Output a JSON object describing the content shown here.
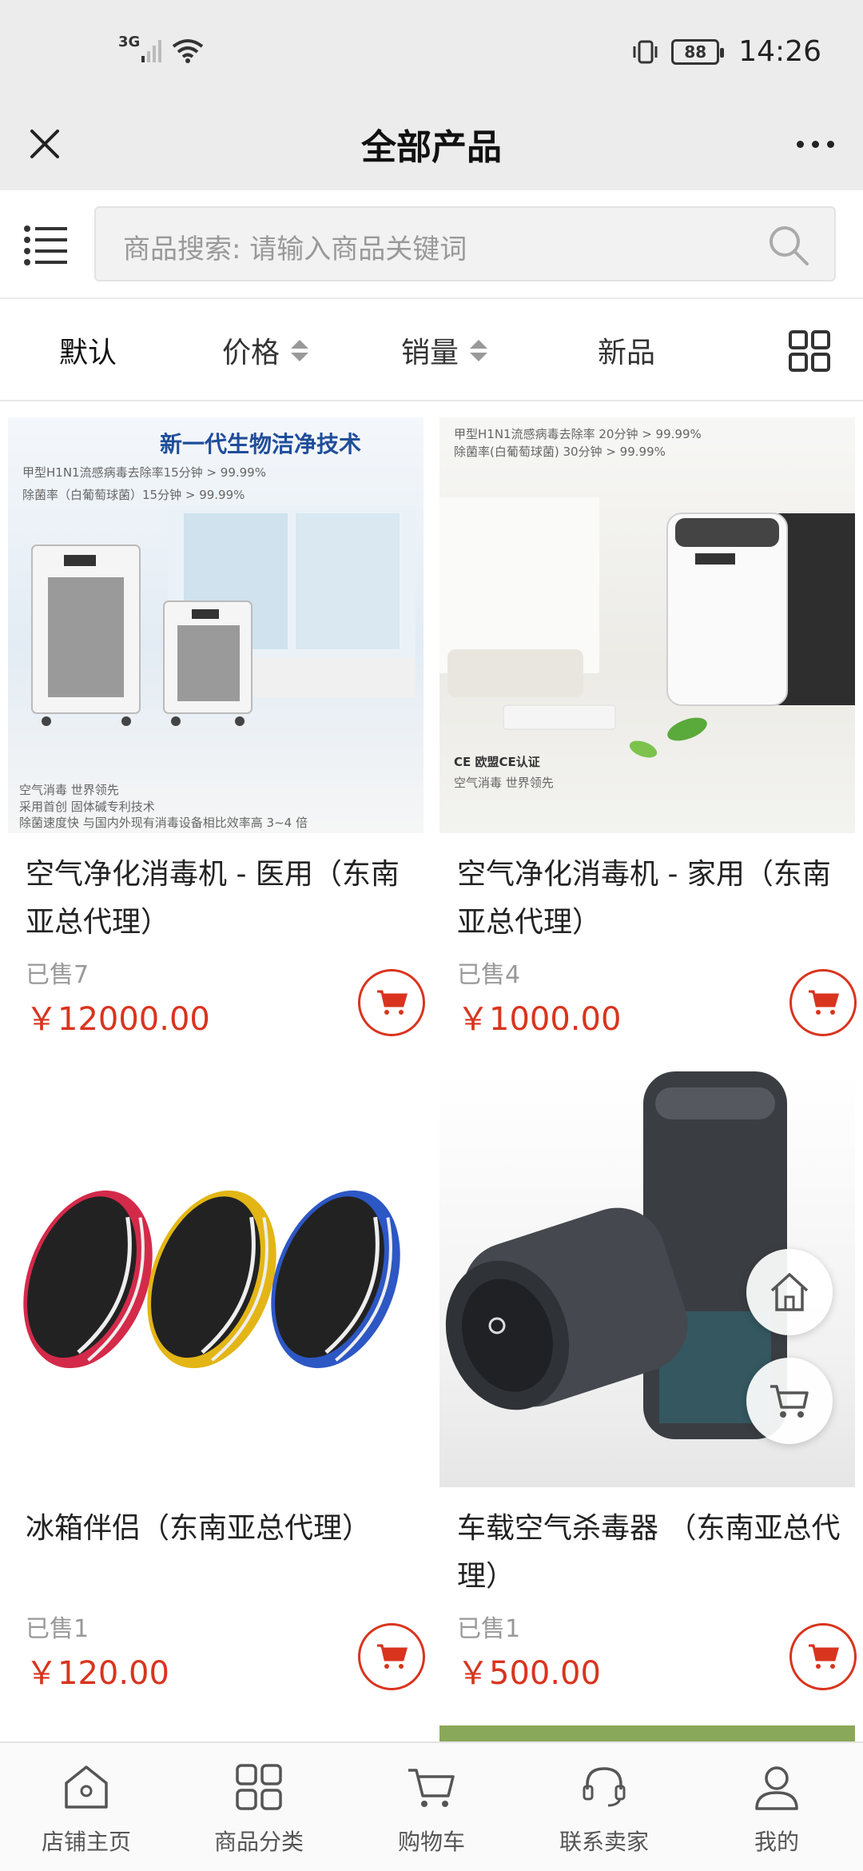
{
  "status_bar": {
    "network": "3G",
    "battery": "88",
    "time": "14:26"
  },
  "header": {
    "title": "全部产品"
  },
  "search": {
    "placeholder": "商品搜索: 请输入商品关键词"
  },
  "sort": {
    "default": "默认",
    "price": "价格",
    "sales": "销量",
    "new": "新品"
  },
  "products": [
    {
      "title": "空气净化消毒机 - 医用（东南亚总代理）",
      "sold": "已售7",
      "price": "￥12000.00",
      "image_text": {
        "headline": "新一代生物洁净技术",
        "line1": "甲型H1N1流感病毒去除率15分钟 > 99.99%",
        "line2": "除菌率（白葡萄球菌）15分钟 > 99.99%",
        "footer1": "空气消毒  世界领先",
        "footer2": "采用首创  固体碱专利技术",
        "footer3": "除菌速度快 与国内外现有消毒设备相比效率高 3~4 倍"
      }
    },
    {
      "title": "空气净化消毒机 - 家用（东南亚总代理）",
      "sold": "已售4",
      "price": "￥1000.00",
      "image_text": {
        "line1": "甲型H1N1流感病毒去除率 20分钟 > 99.99%",
        "line2": "除菌率(白葡萄球菌) 30分钟 > 99.99%",
        "ce": "CE 欧盟CE认证",
        "footer1": "空气消毒 世界领先"
      }
    },
    {
      "title": "冰箱伴侣（东南亚总代理）",
      "sold": "已售1",
      "price": "￥120.00"
    },
    {
      "title": "车载空气杀毒器 （东南亚总代理）",
      "sold": "已售1",
      "price": "￥500.00"
    }
  ],
  "bottom_nav": [
    {
      "label": "店铺主页",
      "icon": "store-home-icon"
    },
    {
      "label": "商品分类",
      "icon": "category-grid-icon"
    },
    {
      "label": "购物车",
      "icon": "cart-icon"
    },
    {
      "label": "联系卖家",
      "icon": "headset-icon"
    },
    {
      "label": "我的",
      "icon": "user-icon"
    }
  ],
  "colors": {
    "accent": "#d9341e",
    "bar_bg": "#ececec"
  }
}
